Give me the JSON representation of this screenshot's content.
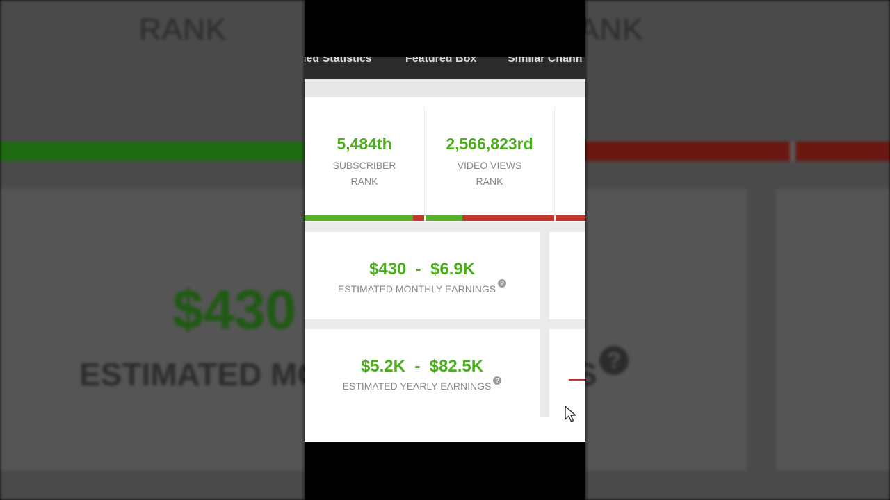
{
  "background": {
    "rank_left": "RANK",
    "rank_right": "ANK",
    "big_value": "$430",
    "estimated": "ESTIMATED MO",
    "s_fragment": "S",
    "help_glyph": "?"
  },
  "nav": {
    "tabs": [
      "led Statistics",
      "Featured Box",
      "Similar Chann"
    ]
  },
  "ranks": [
    {
      "value": "5,484th",
      "label_line1": "SUBSCRIBER",
      "label_line2": "RANK",
      "green_fraction": 0.9
    },
    {
      "value": "2,566,823rd",
      "label_line1": "VIDEO VIEWS",
      "label_line2": "RANK",
      "green_fraction": 0.28
    }
  ],
  "earnings": {
    "monthly": {
      "range": "$430  -  $6.9K",
      "label": "ESTIMATED MONTHLY EARNINGS"
    },
    "yearly": {
      "range": "$5.2K  -  $82.5K",
      "label": "ESTIMATED YEARLY EARNINGS"
    },
    "help_glyph": "?"
  },
  "colors": {
    "green": "#4cae1c",
    "red": "#c1392b",
    "nav": "#2b2b2b"
  }
}
